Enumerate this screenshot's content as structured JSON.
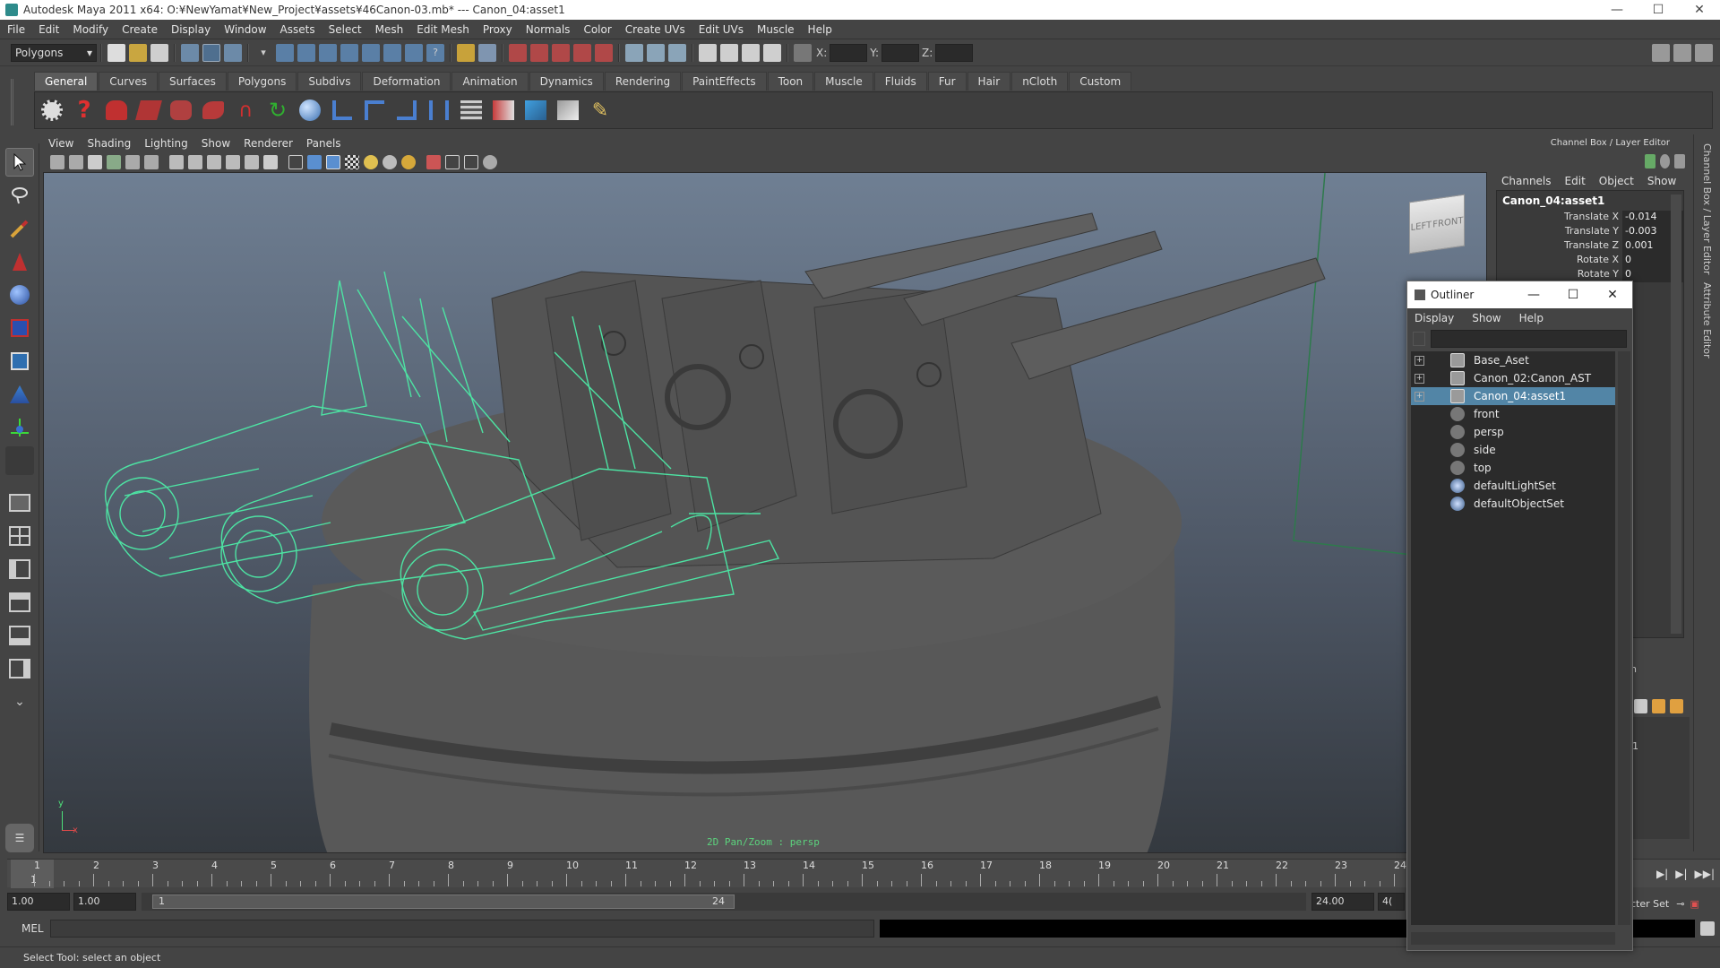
{
  "window": {
    "title": "Autodesk Maya 2011 x64: O:¥NewYamat¥New_Project¥assets¥46Canon-03.mb*   ---   Canon_04:asset1",
    "controls": [
      "—",
      "☐",
      "✕"
    ]
  },
  "menubar": [
    "File",
    "Edit",
    "Modify",
    "Create",
    "Display",
    "Window",
    "Assets",
    "Select",
    "Mesh",
    "Edit Mesh",
    "Proxy",
    "Normals",
    "Color",
    "Create UVs",
    "Edit UVs",
    "Muscle",
    "Help"
  ],
  "statusline": {
    "menuset": "Polygons",
    "x_label": "X:",
    "y_label": "Y:",
    "z_label": "Z:"
  },
  "shelf": {
    "tabs": [
      "General",
      "Curves",
      "Surfaces",
      "Polygons",
      "Subdivs",
      "Deformation",
      "Animation",
      "Dynamics",
      "Rendering",
      "PaintEffects",
      "Toon",
      "Muscle",
      "Fluids",
      "Fur",
      "Hair",
      "nCloth",
      "Custom"
    ],
    "active_tab": "General"
  },
  "viewport": {
    "menu": [
      "View",
      "Shading",
      "Lighting",
      "Show",
      "Renderer",
      "Panels"
    ],
    "hud_label": "2D Pan/Zoom : persp",
    "viewcube_left": "LEFT",
    "viewcube_front": "FRONT",
    "axis_x": "x",
    "axis_y": "y",
    "colors": {
      "wireframe": "#4de3a3",
      "bg_top": "#6f7f93",
      "bg_bottom": "#34393f",
      "hud": "#5cd37d"
    }
  },
  "channelbox": {
    "panel_title": "Channel Box / Layer Editor",
    "menu": [
      "Channels",
      "Edit",
      "Object",
      "Show"
    ],
    "object": "Canon_04:asset1",
    "attributes": [
      {
        "name": "Translate X",
        "value": "-0.014"
      },
      {
        "name": "Translate Y",
        "value": "-0.003"
      },
      {
        "name": "Translate Z",
        "value": "0.001"
      },
      {
        "name": "Rotate X",
        "value": "0"
      },
      {
        "name": "Rotate Y",
        "value": "0"
      }
    ],
    "layer_fragment": "n",
    "layer_number": "1",
    "char_set": "cter Set"
  },
  "side_tabs": [
    "Channel Box / Layer Editor",
    "Attribute Editor"
  ],
  "outliner": {
    "title": "Outliner",
    "menu": [
      "Display",
      "Show",
      "Help"
    ],
    "items": [
      {
        "label": "Base_Aset",
        "type": "transform",
        "expandable": true
      },
      {
        "label": "Canon_02:Canon_AST",
        "type": "transform",
        "expandable": true
      },
      {
        "label": "Canon_04:asset1",
        "type": "transform",
        "expandable": true,
        "selected": true
      },
      {
        "label": "front",
        "type": "camera"
      },
      {
        "label": "persp",
        "type": "camera"
      },
      {
        "label": "side",
        "type": "camera"
      },
      {
        "label": "top",
        "type": "camera"
      },
      {
        "label": "defaultLightSet",
        "type": "set"
      },
      {
        "label": "defaultObjectSet",
        "type": "set"
      }
    ]
  },
  "timeline": {
    "ticks": [
      "1",
      "2",
      "3",
      "4",
      "5",
      "6",
      "7",
      "8",
      "9",
      "10",
      "11",
      "12",
      "13",
      "14",
      "15",
      "16",
      "17",
      "18",
      "19",
      "20",
      "21",
      "22",
      "23",
      "24"
    ],
    "current": "1"
  },
  "range": {
    "start": "1.00",
    "anim_start": "1.00",
    "slider_start": "1",
    "slider_end": "24",
    "end": "24.00",
    "extra": "4("
  },
  "cmdline": {
    "label": "MEL"
  },
  "helpline": "Select Tool: select an object"
}
